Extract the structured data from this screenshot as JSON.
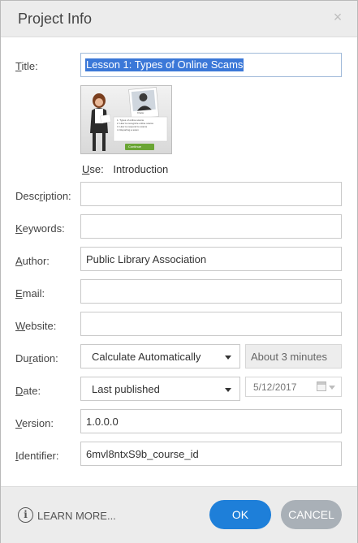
{
  "dialog": {
    "title": "Project Info",
    "close_glyph": "×"
  },
  "form": {
    "title": {
      "label_u": "T",
      "label_rest": "itle:",
      "value": "Lesson 1: Types of Online Scams"
    },
    "use": {
      "label_u": "U",
      "label_rest": "se:",
      "value": "Introduction"
    },
    "description": {
      "label_pre": "Desc",
      "label_u": "r",
      "label_rest": "iption:",
      "value": ""
    },
    "keywords": {
      "label_u": "K",
      "label_rest": "eywords:",
      "value": ""
    },
    "author": {
      "label_u": "A",
      "label_rest": "uthor:",
      "value": "Public Library Association"
    },
    "email": {
      "label_u": "E",
      "label_rest": "mail:",
      "value": ""
    },
    "website": {
      "label_u": "W",
      "label_rest": "ebsite:",
      "value": ""
    },
    "duration": {
      "label_pre": "Du",
      "label_u": "r",
      "label_rest": "ation:",
      "selected": "Calculate Automatically",
      "computed": "About 3 minutes"
    },
    "date": {
      "label_u": "D",
      "label_rest": "ate:",
      "selected": "Last published",
      "value": "5/12/2017"
    },
    "version": {
      "label_u": "V",
      "label_rest": "ersion:",
      "value": "1.0.0.0"
    },
    "identifier": {
      "label_u": "I",
      "label_rest": "dentifier:",
      "value": "6mvl8ntxS9b_course_id"
    }
  },
  "thumbnail": {
    "name_tag": "Khalie",
    "bullets": [
      "1.  Types of online scams",
      "2.  How to recognize online scams",
      "3.  How to respond to scams",
      "4.  Reporting a scam"
    ],
    "continue_label": "Continue"
  },
  "footer": {
    "learn_more": "LEARN MORE...",
    "ok_label": "OK",
    "cancel_label": "CANCEL"
  },
  "icons": {
    "info": "i"
  },
  "colors": {
    "selection": "#3b78d8",
    "ok": "#1e7fd9",
    "cancel": "#a9b0b7"
  }
}
